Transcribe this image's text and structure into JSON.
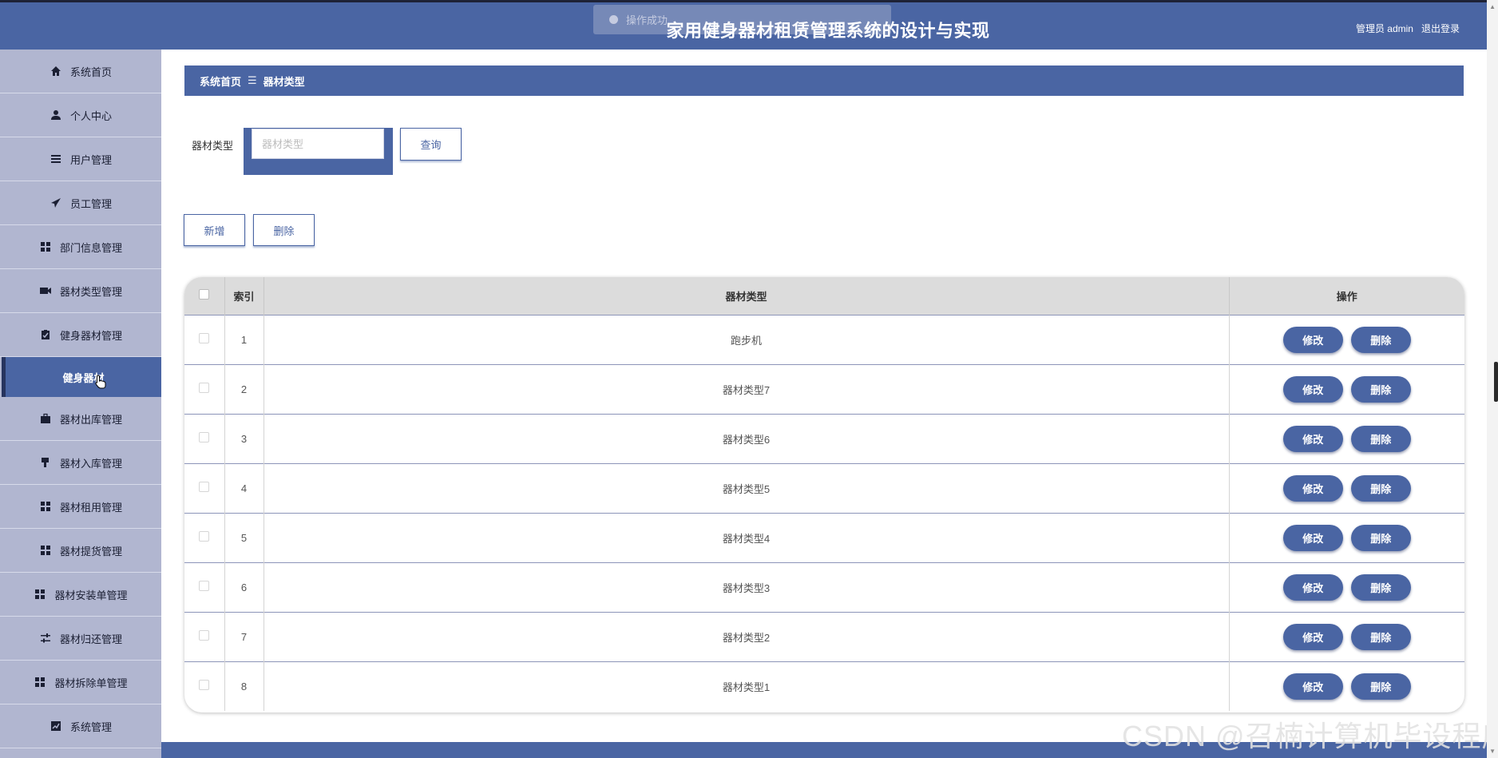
{
  "header": {
    "title": "家用健身器材租赁管理系统的设计与实现",
    "user_label": "管理员 admin",
    "logout_label": "退出登录",
    "toast_text": "操作成功"
  },
  "sidebar": {
    "items": [
      {
        "label": "系统首页",
        "icon": "home-icon"
      },
      {
        "label": "个人中心",
        "icon": "user-icon"
      },
      {
        "label": "用户管理",
        "icon": "list-icon"
      },
      {
        "label": "员工管理",
        "icon": "paper-plane-icon"
      },
      {
        "label": "部门信息管理",
        "icon": "grid-icon"
      },
      {
        "label": "器材类型管理",
        "icon": "video-camera-icon"
      },
      {
        "label": "健身器材管理",
        "icon": "clipboard-icon"
      },
      {
        "label": "健身器材",
        "icon": ""
      },
      {
        "label": "器材出库管理",
        "icon": "briefcase-icon"
      },
      {
        "label": "器材入库管理",
        "icon": "mug-icon"
      },
      {
        "label": "器材租用管理",
        "icon": "grid-icon"
      },
      {
        "label": "器材提货管理",
        "icon": "grid-icon"
      },
      {
        "label": "器材安装单管理",
        "icon": "grid-icon"
      },
      {
        "label": "器材归还管理",
        "icon": "sliders-icon"
      },
      {
        "label": "器材拆除单管理",
        "icon": "grid-icon"
      },
      {
        "label": "系统管理",
        "icon": "chart-icon"
      }
    ]
  },
  "breadcrumb": {
    "home": "系统首页",
    "separator": "☰",
    "current": "器材类型"
  },
  "search": {
    "label": "器材类型",
    "placeholder": "器材类型",
    "value": "",
    "button": "查询"
  },
  "actions": {
    "add": "新增",
    "delete": "删除"
  },
  "table": {
    "headers": {
      "index": "索引",
      "type": "器材类型",
      "ops": "操作"
    },
    "edit_label": "修改",
    "delete_label": "删除",
    "rows": [
      {
        "index": "1",
        "type": "跑步机"
      },
      {
        "index": "2",
        "type": "器材类型7"
      },
      {
        "index": "3",
        "type": "器材类型6"
      },
      {
        "index": "4",
        "type": "器材类型5"
      },
      {
        "index": "5",
        "type": "器材类型4"
      },
      {
        "index": "6",
        "type": "器材类型3"
      },
      {
        "index": "7",
        "type": "器材类型2"
      },
      {
        "index": "8",
        "type": "器材类型1"
      }
    ]
  },
  "watermark": "CSDN @召楠计算机毕设程序",
  "colors": {
    "primary": "#4a65a3",
    "sidebar_bg": "#b1b6d0",
    "table_header_bg": "#dcdcdc"
  }
}
